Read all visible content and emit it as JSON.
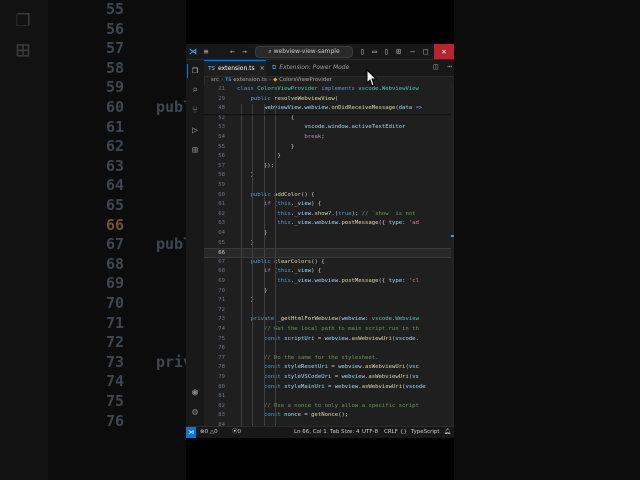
{
  "background": {
    "left_lines": [
      {
        "num": "55",
        "code": "",
        "hl": false
      },
      {
        "num": "56",
        "code": "",
        "hl": false
      },
      {
        "num": "57",
        "code": "",
        "hl": false
      },
      {
        "num": "58",
        "code": "",
        "hl": false
      },
      {
        "num": "59",
        "code": "",
        "hl": false
      },
      {
        "num": "60",
        "code": "publ",
        "hl": false
      },
      {
        "num": "61",
        "code": "",
        "hl": false
      },
      {
        "num": "62",
        "code": "",
        "hl": false
      },
      {
        "num": "63",
        "code": "",
        "hl": false
      },
      {
        "num": "64",
        "code": "",
        "hl": false
      },
      {
        "num": "65",
        "code": "",
        "hl": false
      },
      {
        "num": "66",
        "code": "",
        "hl": true
      },
      {
        "num": "67",
        "code": "publ",
        "hl": false
      },
      {
        "num": "68",
        "code": "",
        "hl": false
      },
      {
        "num": "69",
        "code": "",
        "hl": false
      },
      {
        "num": "70",
        "code": "",
        "hl": false
      },
      {
        "num": "71",
        "code": "",
        "hl": false
      },
      {
        "num": "72",
        "code": "",
        "hl": false
      },
      {
        "num": "73",
        "code": "priv",
        "hl": false
      },
      {
        "num": "74",
        "code": "",
        "hl": false
      },
      {
        "num": "75",
        "code": "",
        "hl": false
      },
      {
        "num": "76",
        "code": "",
        "hl": false
      }
    ],
    "right_lines": [
      {
        "code": "`show` is not"
      },
      {
        "code": "ge({ type: 'ad"
      },
      {
        "code": "ge({ type: 'cl"
      },
      {
        "code": "vscode.Webview"
      },
      {
        "code": "ript run in th"
      },
      {
        "code": "iewUri(vscode."
      },
      {
        "code": "t."
      }
    ]
  },
  "titlebar": {
    "command_center": "webview-view-sample",
    "back_arrow": "←",
    "forward_arrow": "→"
  },
  "tabs": [
    {
      "label": "extension.ts",
      "prefix": "TS",
      "active": true,
      "close": "×"
    },
    {
      "label": "Extension: Power Mode",
      "prefix": "⧉",
      "active": false,
      "close": ""
    }
  ],
  "breadcrumb": {
    "folder": "src",
    "file": "extension.ts",
    "file_prefix": "TS",
    "symbol": "ColorsViewProvider"
  },
  "editor": {
    "current_line": "66",
    "lines": [
      {
        "num": "21",
        "html": "<span class='k'>class</span> <span class='t'>ColorsViewProvider</span> <span class='k'>implements</span> <span class='t'>vscode</span>.<span class='t'>WebviewView</span>"
      },
      {
        "num": "29",
        "html": "    <span class='k'>public</span> <span class='f'>resolveWebviewView</span>("
      },
      {
        "num": "48",
        "html": "        <span class='v'>webviewView</span>.<span class='v'>webview</span>.<span class='f'>onDidReceiveMessage</span>(<span class='v'>data</span> <span class='k'>=&gt;</span>"
      },
      {
        "num": "52",
        "html": "                {"
      },
      {
        "num": "53",
        "html": "                    <span class='v'>vscode</span>.<span class='v'>window</span>.<span class='v'>activeTextEditor</span>"
      },
      {
        "num": "54",
        "html": "                    <span class='c'>break</span>;"
      },
      {
        "num": "55",
        "html": "                }"
      },
      {
        "num": "56",
        "html": "            }"
      },
      {
        "num": "57",
        "html": "        });"
      },
      {
        "num": "58",
        "html": "    }"
      },
      {
        "num": "59",
        "html": ""
      },
      {
        "num": "60",
        "html": "    <span class='k'>public</span> <span class='f'>addColor</span>() {"
      },
      {
        "num": "61",
        "html": "        <span class='c'>if</span> (<span class='k'>this</span>.<span class='v'>_view</span>) {"
      },
      {
        "num": "62",
        "html": "            <span class='k'>this</span>.<span class='v'>_view</span>.<span class='f'>show</span>?.(<span class='k'>true</span>); <span class='cm'>// `show` is not</span>"
      },
      {
        "num": "63",
        "html": "            <span class='k'>this</span>.<span class='v'>_view</span>.<span class='v'>webview</span>.<span class='f'>postMessage</span>({ <span class='v'>type</span>: <span class='s'>'ad</span>"
      },
      {
        "num": "64",
        "html": "        }"
      },
      {
        "num": "65",
        "html": "    }"
      },
      {
        "num": "66",
        "html": ""
      },
      {
        "num": "67",
        "html": "    <span class='k'>public</span> <span class='f'>clearColors</span>() {"
      },
      {
        "num": "68",
        "html": "        <span class='c'>if</span> (<span class='k'>this</span>.<span class='v'>_view</span>) {"
      },
      {
        "num": "69",
        "html": "            <span class='k'>this</span>.<span class='v'>_view</span>.<span class='v'>webview</span>.<span class='f'>postMessage</span>({ <span class='v'>type</span>: <span class='s'>'cl</span>"
      },
      {
        "num": "70",
        "html": "        }"
      },
      {
        "num": "71",
        "html": "    }"
      },
      {
        "num": "72",
        "html": ""
      },
      {
        "num": "73",
        "html": "    <span class='k'>private</span> <span class='f'>_getHtmlForWebview</span>(<span class='v'>webview</span>: <span class='t'>vscode</span>.<span class='t'>Webview</span>"
      },
      {
        "num": "74",
        "html": "        <span class='cm'>// Get the local path to main script run in th</span>"
      },
      {
        "num": "75",
        "html": "        <span class='k'>const</span> <span class='v'>scriptUri</span> = <span class='v'>webview</span>.<span class='f'>asWebviewUri</span>(<span class='v'>vscode</span>."
      },
      {
        "num": "76",
        "html": ""
      },
      {
        "num": "77",
        "html": "        <span class='cm'>// Do the same for the stylesheet.</span>"
      },
      {
        "num": "78",
        "html": "        <span class='k'>const</span> <span class='v'>styleResetUri</span> = <span class='v'>webview</span>.<span class='f'>asWebviewUri</span>(<span class='v'>vsc</span>"
      },
      {
        "num": "79",
        "html": "        <span class='k'>const</span> <span class='v'>styleVSCodeUri</span> = <span class='v'>webview</span>.<span class='f'>asWebviewUri</span>(<span class='v'>vs</span>"
      },
      {
        "num": "80",
        "html": "        <span class='k'>const</span> <span class='v'>styleMainUri</span> = <span class='v'>webview</span>.<span class='f'>asWebviewUri</span>(<span class='v'>vscode</span>"
      },
      {
        "num": "81",
        "html": ""
      },
      {
        "num": "82",
        "html": "        <span class='cm'>// Use a nonce to only allow a specific script</span>"
      },
      {
        "num": "83",
        "html": "        <span class='k'>const</span> <span class='v'>nonce</span> = <span class='f'>getNonce</span>();"
      },
      {
        "num": "84",
        "html": ""
      },
      {
        "num": "85",
        "html": "        <span class='c'>return</span> <span class='s'>`&lt;!DOCTYPE html&gt;</span>"
      },
      {
        "num": "86",
        "html": "            <span class='tag'>&lt;</span><span class='k'>html</span> <span class='v'>lang</span>=<span class='s'>\"en\"</span><span class='tag'>&gt;</span>"
      },
      {
        "num": "87",
        "html": "            <span class='tag'>&lt;</span><span class='k'>head</span><span class='tag'>&gt;</span>"
      }
    ]
  },
  "statusbar": {
    "errors": "0",
    "warnings": "0",
    "ports": "0",
    "position": "Ln 66, Col 1",
    "tab_size": "Tab Size: 4",
    "encoding": "UTF-8",
    "eol": "CRLF",
    "language": "TypeScript"
  },
  "colors": {
    "accent": "#0078d4",
    "editor_bg": "#1f1f1f",
    "close_red": "#b3262e",
    "ts_blue": "#3a96dd"
  }
}
